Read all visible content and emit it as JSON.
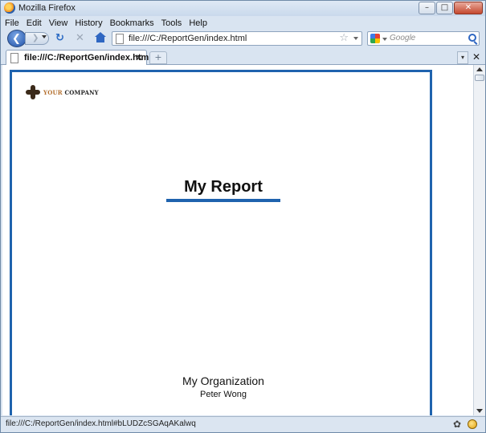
{
  "window": {
    "title": "Mozilla Firefox"
  },
  "menu": [
    "File",
    "Edit",
    "View",
    "History",
    "Bookmarks",
    "Tools",
    "Help"
  ],
  "nav": {
    "url": "file:///C:/ReportGen/index.html",
    "search_placeholder": "Google"
  },
  "tabs": [
    {
      "label": "file:///C:/ReportGen/index.html"
    }
  ],
  "page": {
    "logo_your": "YOUR",
    "logo_company": "COMPANY",
    "title": "My Report",
    "organization": "My Organization",
    "author": "Peter Wong"
  },
  "status": {
    "text": "file:///C:/ReportGen/index.html#bLUDZcSGAqAKalwq"
  },
  "icons": {
    "back": "back-arrow-icon",
    "forward": "forward-arrow-icon",
    "reload": "reload-icon",
    "stop": "stop-icon",
    "home": "home-icon",
    "bookmark": "star-icon",
    "search_engine": "google-icon",
    "search": "magnifier-icon"
  },
  "colors": {
    "accent": "#1f63ae",
    "logo_accent": "#b4702f"
  }
}
